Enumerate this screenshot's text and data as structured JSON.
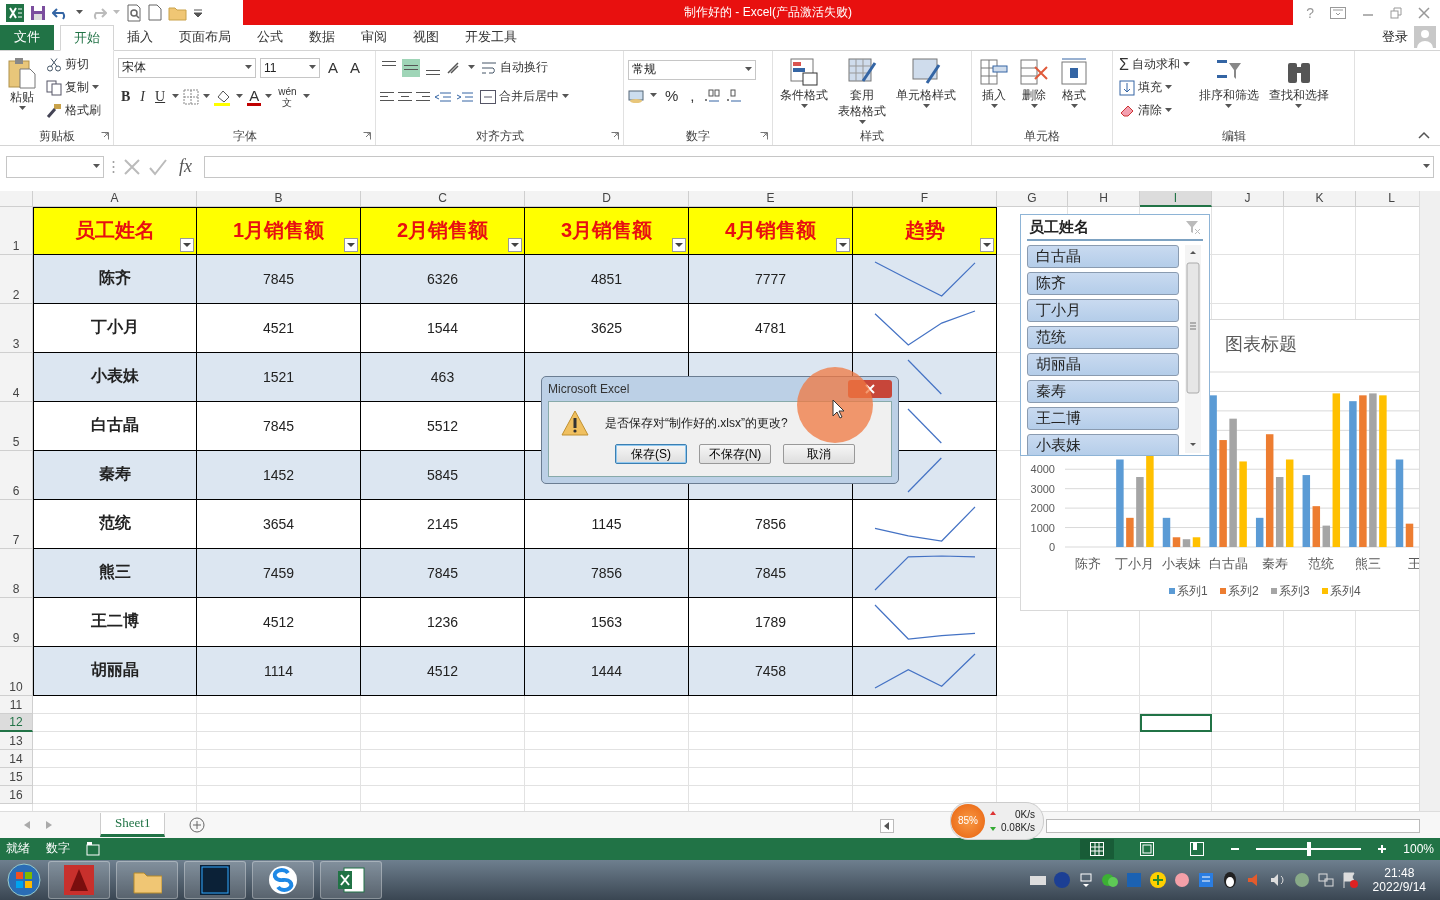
{
  "title_bar": {
    "title": "制作好的 - Excel(产品激活失败)",
    "help": "?"
  },
  "ribbon_tabs": [
    {
      "label": "文件",
      "kind": "file",
      "selected": false
    },
    {
      "label": "开始",
      "kind": "tab",
      "selected": true
    },
    {
      "label": "插入",
      "kind": "tab",
      "selected": false
    },
    {
      "label": "页面布局",
      "kind": "tab",
      "selected": false
    },
    {
      "label": "公式",
      "kind": "tab",
      "selected": false
    },
    {
      "label": "数据",
      "kind": "tab",
      "selected": false
    },
    {
      "label": "审阅",
      "kind": "tab",
      "selected": false
    },
    {
      "label": "视图",
      "kind": "tab",
      "selected": false
    },
    {
      "label": "开发工具",
      "kind": "tab",
      "selected": false
    }
  ],
  "account": {
    "sign_in": "登录"
  },
  "ribbon": {
    "clipboard": {
      "label": "剪贴板",
      "paste": "粘贴",
      "cut": "剪切",
      "copy": "复制",
      "format_painter": "格式刷"
    },
    "font": {
      "label": "字体",
      "font_name": "宋体",
      "font_size": "11",
      "grow": "A",
      "shrink": "A",
      "bold": "B",
      "italic": "I",
      "underline": "U",
      "font_color": "A",
      "phonetic": "wén",
      "phonetic_char": "文"
    },
    "alignment": {
      "label": "对齐方式",
      "vertical_align": [
        {
          "selected": false
        },
        {
          "selected": true
        },
        {
          "selected": false
        }
      ],
      "wrap_text": "自动换行",
      "merge_center": "合并后居中"
    },
    "number": {
      "label": "数字",
      "format": "常规",
      "percent": "%",
      "comma": ","
    },
    "styles": {
      "label": "样式",
      "conditional": "条件格式",
      "table_format": [
        "套用",
        "表格格式"
      ],
      "cell_styles": "单元格样式"
    },
    "cells": {
      "label": "单元格",
      "insert": "插入",
      "delete": "删除",
      "format": "格式"
    },
    "editing": {
      "label": "编辑",
      "autosum_symbol": "Σ",
      "autosum": "自动求和",
      "fill": "填充",
      "clear": "清除",
      "sort_filter": "排序和筛选",
      "find_select": "查找和选择"
    }
  },
  "formula_bar": {
    "fx": "fx"
  },
  "columns": [
    {
      "label": "A",
      "selected": false
    },
    {
      "label": "B",
      "selected": false
    },
    {
      "label": "C",
      "selected": false
    },
    {
      "label": "D",
      "selected": false
    },
    {
      "label": "E",
      "selected": false
    },
    {
      "label": "F",
      "selected": false
    },
    {
      "label": "G",
      "selected": false
    },
    {
      "label": "H",
      "selected": false
    },
    {
      "label": "I",
      "selected": true
    },
    {
      "label": "J",
      "selected": false
    },
    {
      "label": "K",
      "selected": false
    },
    {
      "label": "L",
      "selected": false
    }
  ],
  "row_numbers": [
    {
      "label": "1",
      "selected": false
    },
    {
      "label": "2",
      "selected": false
    },
    {
      "label": "3",
      "selected": false
    },
    {
      "label": "4",
      "selected": false
    },
    {
      "label": "5",
      "selected": false
    },
    {
      "label": "6",
      "selected": false
    },
    {
      "label": "7",
      "selected": false
    },
    {
      "label": "8",
      "selected": false
    },
    {
      "label": "9",
      "selected": false
    },
    {
      "label": "10",
      "selected": false
    },
    {
      "label": "11",
      "selected": false
    },
    {
      "label": "12",
      "selected": true
    },
    {
      "label": "13",
      "selected": false
    },
    {
      "label": "14",
      "selected": false
    },
    {
      "label": "15",
      "selected": false
    },
    {
      "label": "16",
      "selected": false
    }
  ],
  "table": {
    "headers": [
      "员工姓名",
      "1月销售额",
      "2月销售额",
      "3月销售额",
      "4月销售额",
      "趋势"
    ],
    "rows": [
      {
        "name": "陈齐",
        "month_1": "7845",
        "month_2": "6326",
        "month_3": "4851",
        "month_4": "7777"
      },
      {
        "name": "丁小月",
        "month_1": "4521",
        "month_2": "1544",
        "month_3": "3625",
        "month_4": "4781"
      },
      {
        "name": "小表妹",
        "month_1": "1521",
        "month_2": "463"
      },
      {
        "name": "白古晶",
        "month_1": "7845",
        "month_2": "5512"
      },
      {
        "name": "秦寿",
        "month_1": "1452",
        "month_2": "5845"
      },
      {
        "name": "范统",
        "month_1": "3654",
        "month_2": "2145",
        "month_3": "1145",
        "month_4": "7856"
      },
      {
        "name": "熊三",
        "month_1": "7459",
        "month_2": "7845",
        "month_3": "7856",
        "month_4": "7845"
      },
      {
        "name": "王二博",
        "month_1": "4512",
        "month_2": "1236",
        "month_3": "1563",
        "month_4": "1789"
      },
      {
        "name": "胡丽晶",
        "month_1": "1114",
        "month_2": "4512",
        "month_3": "1444",
        "month_4": "7458"
      }
    ]
  },
  "slicer": {
    "title": "员工姓名",
    "items": [
      {
        "label": "白古晶",
        "selected": true
      },
      {
        "label": "陈齐",
        "selected": true
      },
      {
        "label": "丁小月",
        "selected": true
      },
      {
        "label": "范统",
        "selected": true
      },
      {
        "label": "胡丽晶",
        "selected": true
      },
      {
        "label": "秦寿",
        "selected": true
      },
      {
        "label": "王二博",
        "selected": true
      },
      {
        "label": "小表妹",
        "selected": true
      }
    ]
  },
  "chart": {
    "chart_data": {
      "type": "bar",
      "title": "图表标题",
      "categories": [
        "陈齐",
        "丁小月",
        "小表妹",
        "白古晶",
        "秦寿",
        "范统",
        "熊三",
        "王"
      ],
      "ylim": [
        0,
        9000
      ],
      "yticks": [
        0,
        1000,
        2000,
        3000,
        4000
      ],
      "grid": true,
      "legend": true,
      "series": [
        {
          "name": "系列1",
          "color": "#5b9bd5",
          "values": [
            null,
            4500,
            1500,
            7800,
            1500,
            3700,
            7500,
            4500
          ]
        },
        {
          "name": "系列2",
          "color": "#ed7d31",
          "values": [
            null,
            1500,
            500,
            5500,
            5800,
            2100,
            7800,
            1200
          ]
        },
        {
          "name": "系列3",
          "color": "#a5a5a5",
          "values": [
            null,
            3600,
            400,
            6600,
            3600,
            1100,
            7900,
            null
          ]
        },
        {
          "name": "系列4",
          "color": "#ffc000",
          "values": [
            null,
            4800,
            500,
            4400,
            4500,
            7900,
            7800,
            null
          ]
        }
      ]
    }
  },
  "dialog": {
    "title": "Microsoft Excel",
    "message": "是否保存对“制作好的.xlsx”的更改?",
    "buttons": [
      {
        "label": "保存(S)",
        "default": true
      },
      {
        "label": "不保存(N)",
        "default": false
      },
      {
        "label": "取消",
        "default": false
      }
    ]
  },
  "sheet_tabs": [
    {
      "label": "Sheet1",
      "selected": true
    }
  ],
  "network_monitor": {
    "percent": "85%",
    "upload": "0K/s",
    "download": "0.08K/s"
  },
  "status_bar": {
    "ready": "就绪",
    "mode": "数字",
    "views": [
      {
        "selected": true
      },
      {
        "selected": false
      },
      {
        "selected": false
      }
    ],
    "zoom": {
      "level": 0.5
    },
    "zoom_percent": "100%"
  },
  "taskbar": {
    "time": "21:48",
    "date": "2022/9/14"
  }
}
